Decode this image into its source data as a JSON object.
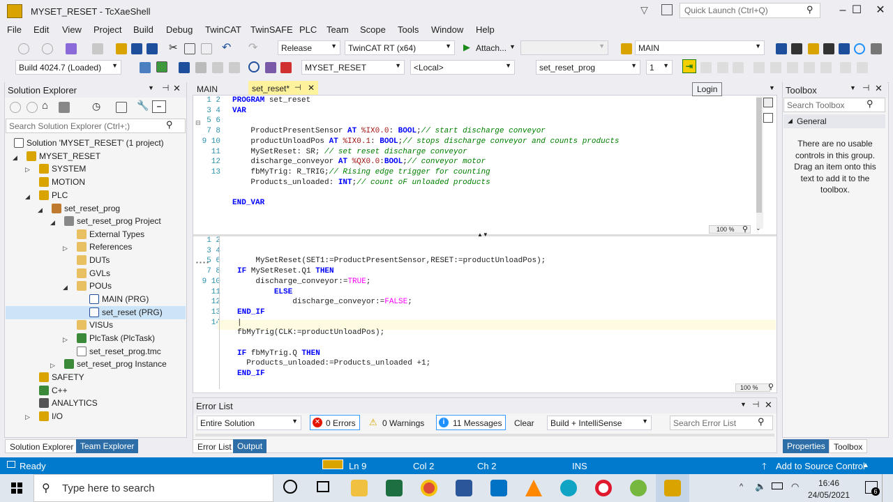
{
  "window": {
    "title": "MYSET_RESET - TcXaeShell",
    "quick_launch_placeholder": "Quick Launch (Ctrl+Q)",
    "min": "–",
    "max": "☐",
    "close": "✕"
  },
  "menu": [
    "File",
    "Edit",
    "View",
    "Project",
    "Build",
    "Debug",
    "TwinCAT",
    "TwinSAFE",
    "PLC",
    "Team",
    "Scope",
    "Tools",
    "Window",
    "Help"
  ],
  "toolbar1": {
    "config": "Release",
    "platform": "TwinCAT RT (x64)",
    "attach": "Attach...",
    "target": "MAIN"
  },
  "toolbar2": {
    "build": "Build 4024.7 (Loaded)",
    "project": "MYSET_RESET",
    "route": "<Local>",
    "plc": "set_reset_prog",
    "instance": "1",
    "tooltip": "Login"
  },
  "solution_explorer": {
    "title": "Solution Explorer",
    "search_placeholder": "Search Solution Explorer (Ctrl+;)",
    "items": [
      {
        "label": "Solution 'MYSET_RESET' (1 project)"
      },
      {
        "label": "MYSET_RESET"
      },
      {
        "label": "SYSTEM"
      },
      {
        "label": "MOTION"
      },
      {
        "label": "PLC"
      },
      {
        "label": "set_reset_prog"
      },
      {
        "label": "set_reset_prog Project"
      },
      {
        "label": "External Types"
      },
      {
        "label": "References"
      },
      {
        "label": "DUTs"
      },
      {
        "label": "GVLs"
      },
      {
        "label": "POUs"
      },
      {
        "label": "MAIN (PRG)"
      },
      {
        "label": "set_reset (PRG)"
      },
      {
        "label": "VISUs"
      },
      {
        "label": "PlcTask (PlcTask)"
      },
      {
        "label": "set_reset_prog.tmc"
      },
      {
        "label": "set_reset_prog Instance"
      },
      {
        "label": "SAFETY"
      },
      {
        "label": "C++"
      },
      {
        "label": "ANALYTICS"
      },
      {
        "label": "I/O"
      }
    ],
    "tab_solution": "Solution Explorer",
    "tab_team": "Team Explorer"
  },
  "editor": {
    "tab_main": "MAIN",
    "tab_active": "set_reset*",
    "zoom_top": "100 %",
    "zoom_bottom": "100 %"
  },
  "toolbox": {
    "title": "Toolbox",
    "search_placeholder": "Search Toolbox",
    "group": "General",
    "empty_text": "There are no usable controls in this group. Drag an item onto this text to add it to the toolbox.",
    "tab_properties": "Properties",
    "tab_toolbox": "Toolbox"
  },
  "error_list": {
    "title": "Error List",
    "scope": "Entire Solution",
    "errors": "0 Errors",
    "warnings": "0 Warnings",
    "messages": "11 Messages",
    "clear": "Clear",
    "build_filter": "Build + IntelliSense",
    "search_placeholder": "Search Error List",
    "tab_errors": "Error List",
    "tab_output": "Output"
  },
  "status": {
    "ready": "Ready",
    "ln": "Ln 9",
    "col": "Col 2",
    "ch": "Ch 2",
    "ins": "INS",
    "source_control": "Add to Source Control"
  },
  "taskbar": {
    "search_placeholder": "Type here to search",
    "time": "16:46",
    "date": "24/05/2021",
    "notifications": "6"
  },
  "colors": {
    "accent": "#007acc",
    "keyword": "#0000ff",
    "comment": "#008000",
    "tab_active": "#fff29d"
  }
}
